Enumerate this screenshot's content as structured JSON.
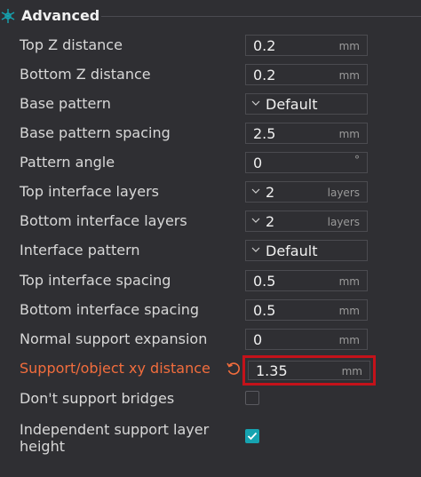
{
  "section": {
    "title": "Advanced",
    "icon": "support-settings-icon"
  },
  "colors": {
    "accent": "#16a3b0",
    "modified": "#f26d3d",
    "highlight_frame": "#c4121a"
  },
  "settings": [
    {
      "label": "Top Z distance",
      "value": "0.2",
      "unit": "mm"
    },
    {
      "label": "Bottom Z distance",
      "value": "0.2",
      "unit": "mm"
    },
    {
      "label": "Base pattern",
      "value": "Default"
    },
    {
      "label": "Base pattern spacing",
      "value": "2.5",
      "unit": "mm"
    },
    {
      "label": "Pattern angle",
      "value": "0",
      "unit": "°"
    },
    {
      "label": "Top interface layers",
      "value": "2",
      "unit": "layers"
    },
    {
      "label": "Bottom interface layers",
      "value": "2",
      "unit": "layers"
    },
    {
      "label": "Interface pattern",
      "value": "Default"
    },
    {
      "label": "Top interface spacing",
      "value": "0.5",
      "unit": "mm"
    },
    {
      "label": "Bottom interface spacing",
      "value": "0.5",
      "unit": "mm"
    },
    {
      "label": "Normal support expansion",
      "value": "0",
      "unit": "mm"
    },
    {
      "label": "Support/object xy distance",
      "value": "1.35",
      "unit": "mm"
    },
    {
      "label": "Don't support bridges",
      "checked": false
    },
    {
      "label": "Independent support layer height",
      "checked": true
    }
  ]
}
